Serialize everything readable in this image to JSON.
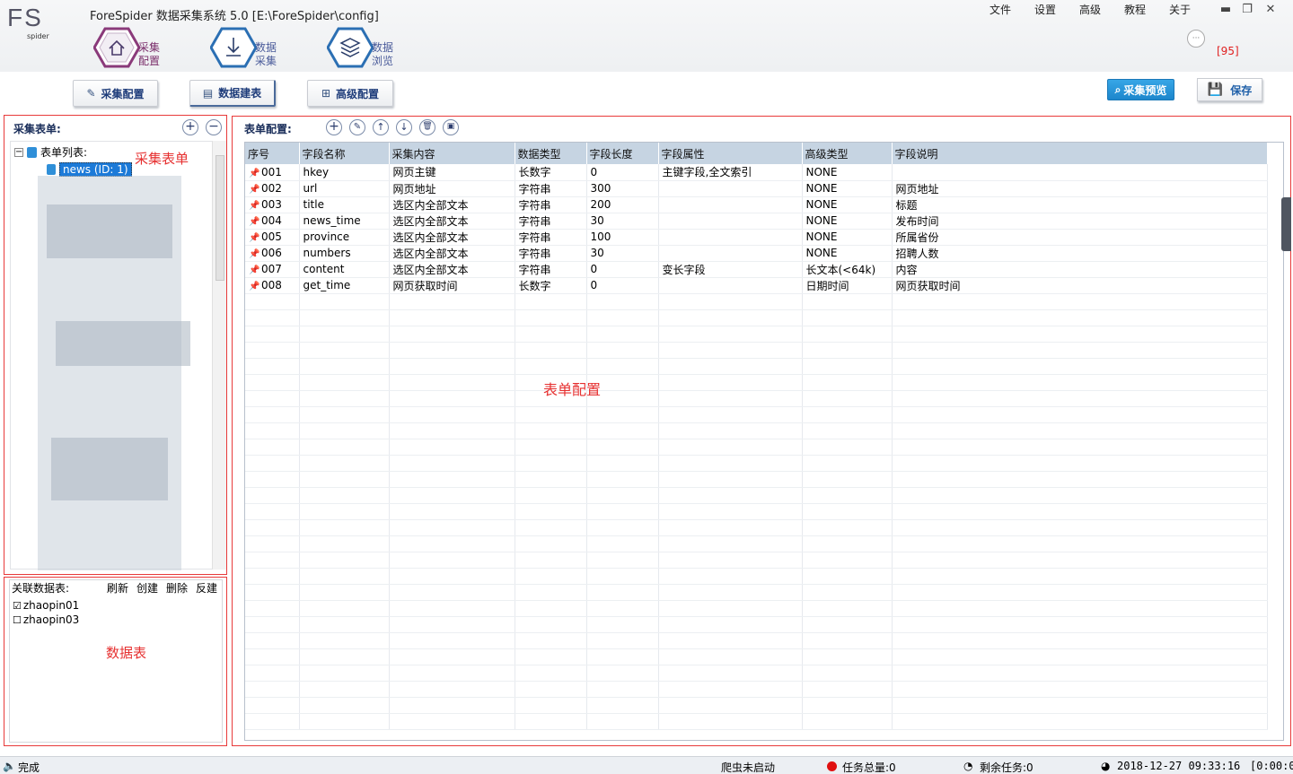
{
  "app": {
    "title": "ForeSpider 数据采集系统  5.0  [E:\\ForeSpider\\config]",
    "logo": "FS",
    "logo_sub": "spider",
    "menu": [
      "文件",
      "设置",
      "高级",
      "教程",
      "关于"
    ],
    "badge": "[95]"
  },
  "nav": [
    {
      "label": "采集配置",
      "icon": "home-icon",
      "active": true
    },
    {
      "label": "数据采集",
      "icon": "download-icon",
      "active": false
    },
    {
      "label": "数据浏览",
      "icon": "layers-icon",
      "active": false
    }
  ],
  "toolbar": {
    "config": "采集配置",
    "table_build": "数据建表",
    "advanced": "高级配置",
    "preview": "采集预览",
    "save": "保存"
  },
  "left": {
    "header": "采集表单:",
    "tree_root": "表单列表:",
    "selected_item": "news (ID: 1)",
    "annotation": "采集表单"
  },
  "related": {
    "header": "关联数据表:",
    "actions": [
      "刷新",
      "创建",
      "删除",
      "反建"
    ],
    "items": [
      {
        "name": "zhaopin01",
        "checked": true
      },
      {
        "name": "zhaopin03",
        "checked": false
      }
    ],
    "annotation": "数据表"
  },
  "form": {
    "header": "表单配置:",
    "annotation": "表单配置",
    "columns": [
      "序号",
      "字段名称",
      "采集内容",
      "数据类型",
      "字段长度",
      "字段属性",
      "高级类型",
      "字段说明"
    ],
    "rows": [
      [
        "001",
        "hkey",
        "网页主键",
        "长数字",
        "0",
        "主键字段,全文索引",
        "NONE",
        ""
      ],
      [
        "002",
        "url",
        "网页地址",
        "字符串",
        "300",
        "",
        "NONE",
        "网页地址"
      ],
      [
        "003",
        "title",
        "选区内全部文本",
        "字符串",
        "200",
        "",
        "NONE",
        "标题"
      ],
      [
        "004",
        "news_time",
        "选区内全部文本",
        "字符串",
        "30",
        "",
        "NONE",
        "发布时间"
      ],
      [
        "005",
        "province",
        "选区内全部文本",
        "字符串",
        "100",
        "",
        "NONE",
        "所属省份"
      ],
      [
        "006",
        "numbers",
        "选区内全部文本",
        "字符串",
        "30",
        "",
        "NONE",
        "招聘人数"
      ],
      [
        "007",
        "content",
        "选区内全部文本",
        "字符串",
        "0",
        "变长字段",
        "长文本(<64k)",
        "内容"
      ],
      [
        "008",
        "get_time",
        "网页获取时间",
        "长数字",
        "0",
        "",
        "日期时间",
        "网页获取时间"
      ]
    ]
  },
  "status": {
    "left": "完成",
    "spider": "爬虫未启动",
    "total": "任务总量:0",
    "remaining": "剩余任务:0",
    "datetime": "2018-12-27 09:33:16",
    "extra": "[0:00:0"
  },
  "colors": {
    "accent": "#1c86cc",
    "annotation": "#e63030",
    "nav_purple": "#8a3a7a",
    "nav_blue": "#2b6fb3"
  }
}
